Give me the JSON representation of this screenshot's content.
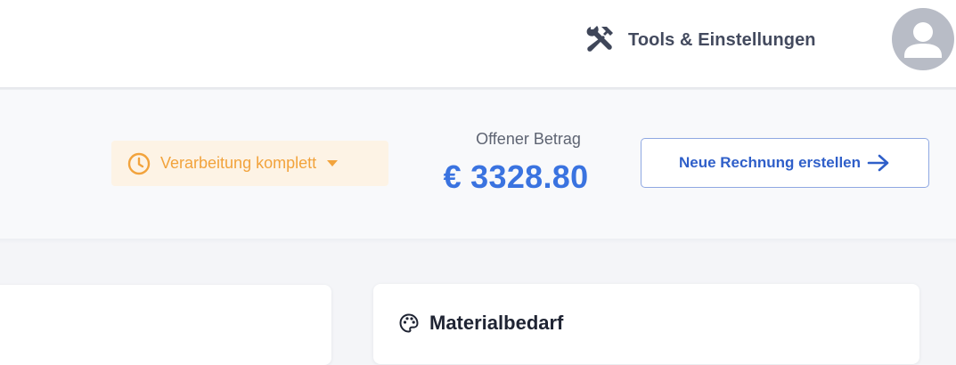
{
  "topbar": {
    "tools_label": "Tools & Einstellungen",
    "tools_icon": "tools-icon",
    "avatar_icon": "user-avatar-icon"
  },
  "header": {
    "status": {
      "label": "Verarbeitung komplett",
      "icon": "clock-icon",
      "color": "#f2a33c",
      "background": "#fdf3e5"
    },
    "open_amount": {
      "label": "Offener Betrag",
      "value": "€ 3328.80",
      "color": "#3a73e0"
    },
    "new_invoice_button": {
      "label": "Neue Rechnung erstellen",
      "icon": "arrow-right-icon"
    }
  },
  "cards": {
    "material": {
      "title": "Materialbedarf",
      "icon": "palette-icon"
    }
  }
}
